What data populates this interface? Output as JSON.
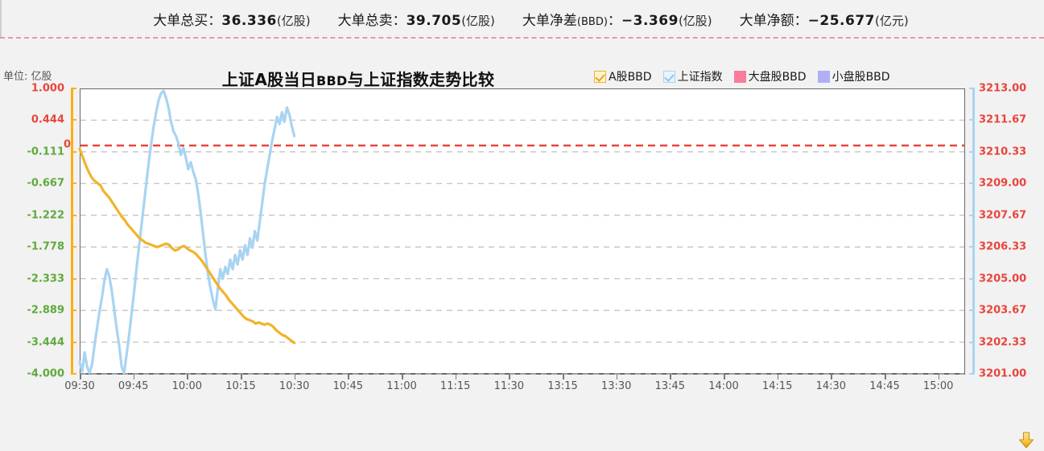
{
  "header": {
    "stats": [
      {
        "name": "total-buy",
        "label": "大单总买：",
        "value": "36.336",
        "unit": "(亿股)",
        "sub": ""
      },
      {
        "name": "total-sell",
        "label": "大单总卖：",
        "value": "39.705",
        "unit": "(亿股)",
        "sub": ""
      },
      {
        "name": "net-diff",
        "label": "大单净差",
        "sub": "(BBD)",
        "label2": "：",
        "value": "−3.369",
        "unit": "(亿股)"
      },
      {
        "name": "net-amount",
        "label": "大单净额：",
        "value": "−25.677",
        "unit": "(亿元)",
        "sub": ""
      }
    ]
  },
  "chart": {
    "unit_label": "单位: 亿股",
    "title_main": "上证A股当日",
    "title_bbd": "BBD",
    "title_tail": "与上证指数走势比较",
    "legend": [
      {
        "label": "A股BBD",
        "state": "checked",
        "color": "#f0b429"
      },
      {
        "label": "上证指数",
        "state": "checked",
        "color": "#a8d4f2"
      },
      {
        "label": "大盘股BBD",
        "state": "swatch",
        "color": "#fb7c9a"
      },
      {
        "label": "小盘股BBD",
        "state": "swatch",
        "color": "#b0aef5"
      }
    ]
  },
  "chart_data": {
    "type": "line",
    "title": "上证A股当日BBD与上证指数走势比较",
    "xlabel": "",
    "ylabel": "单位: 亿股",
    "grid": true,
    "legend_position": "top-right",
    "x_ticks": [
      "09:30",
      "09:45",
      "10:00",
      "10:15",
      "10:30",
      "10:45",
      "11:00",
      "11:15",
      "11:30",
      "13:15",
      "13:30",
      "13:45",
      "14:00",
      "14:15",
      "14:30",
      "14:45",
      "15:00"
    ],
    "y_left": {
      "label": "亿股",
      "ticks": [
        "1.000",
        "0.444",
        "-0.111",
        "-0.667",
        "-1.222",
        "-1.778",
        "-2.333",
        "-2.889",
        "-3.444",
        "-4.000"
      ],
      "tick_colors": [
        "pos",
        "pos",
        "neg",
        "neg",
        "neg",
        "neg",
        "neg",
        "neg",
        "neg",
        "neg"
      ],
      "min": -4.0,
      "max": 1.0,
      "zero_marker": "0",
      "axis_color": "#fcb016"
    },
    "y_right": {
      "ticks": [
        "3213.00",
        "3211.67",
        "3210.33",
        "3209.00",
        "3207.67",
        "3206.33",
        "3205.00",
        "3203.67",
        "3202.33",
        "3201.00"
      ],
      "min": 3201.0,
      "max": 3213.0,
      "axis_color": "#a8d4f2",
      "text_color": "#e8453c"
    },
    "zero_line": {
      "value": 0,
      "color": "#e8453c",
      "style": "dashed"
    },
    "series": [
      {
        "name": "A股BBD",
        "color": "#f0b429",
        "axis": "left",
        "values": [
          -0.06,
          -0.2,
          -0.34,
          -0.46,
          -0.56,
          -0.62,
          -0.66,
          -0.7,
          -0.8,
          -0.86,
          -0.92,
          -1.0,
          -1.08,
          -1.16,
          -1.24,
          -1.3,
          -1.38,
          -1.44,
          -1.5,
          -1.56,
          -1.62,
          -1.66,
          -1.7,
          -1.72,
          -1.74,
          -1.76,
          -1.78,
          -1.76,
          -1.74,
          -1.72,
          -1.74,
          -1.8,
          -1.84,
          -1.82,
          -1.78,
          -1.76,
          -1.8,
          -1.84,
          -1.86,
          -1.9,
          -1.96,
          -2.02,
          -2.1,
          -2.18,
          -2.26,
          -2.34,
          -2.42,
          -2.5,
          -2.56,
          -2.62,
          -2.7,
          -2.76,
          -2.82,
          -2.88,
          -2.94,
          -3.0,
          -3.04,
          -3.06,
          -3.08,
          -3.12,
          -3.1,
          -3.12,
          -3.14,
          -3.12,
          -3.14,
          -3.18,
          -3.24,
          -3.28,
          -3.32,
          -3.34,
          -3.38,
          -3.42,
          -3.46
        ]
      },
      {
        "name": "上证指数",
        "color": "#a8d4f2",
        "axis": "right",
        "values": [
          3201.5,
          3201.1,
          3201.9,
          3201.3,
          3201.0,
          3201.4,
          3202.2,
          3202.9,
          3203.6,
          3204.2,
          3204.9,
          3205.4,
          3205.1,
          3204.5,
          3203.7,
          3202.9,
          3202.2,
          3201.3,
          3201.0,
          3201.8,
          3202.6,
          3203.5,
          3204.4,
          3205.4,
          3206.3,
          3207.2,
          3208.1,
          3209.0,
          3209.9,
          3210.7,
          3211.4,
          3212.0,
          3212.5,
          3212.8,
          3212.9,
          3212.6,
          3212.2,
          3211.6,
          3211.2,
          3211.0,
          3210.7,
          3210.2,
          3210.5,
          3210.1,
          3209.6,
          3209.9,
          3209.5,
          3209.2,
          3208.6,
          3207.8,
          3206.9,
          3206.0,
          3205.2,
          3204.6,
          3204.1,
          3203.7,
          3204.6,
          3205.4,
          3205.0,
          3205.5,
          3205.2,
          3205.8,
          3205.4,
          3206.0,
          3205.6,
          3206.2,
          3205.8,
          3206.4,
          3206.0,
          3206.7,
          3206.3,
          3207.0,
          3206.6,
          3207.4,
          3208.2,
          3209.0,
          3209.6,
          3210.2,
          3210.8,
          3211.3,
          3211.8,
          3211.5,
          3212.0,
          3211.6,
          3212.2,
          3211.9,
          3211.4,
          3211.0
        ]
      }
    ]
  },
  "footer": {
    "scroll_button": "scroll-down"
  }
}
